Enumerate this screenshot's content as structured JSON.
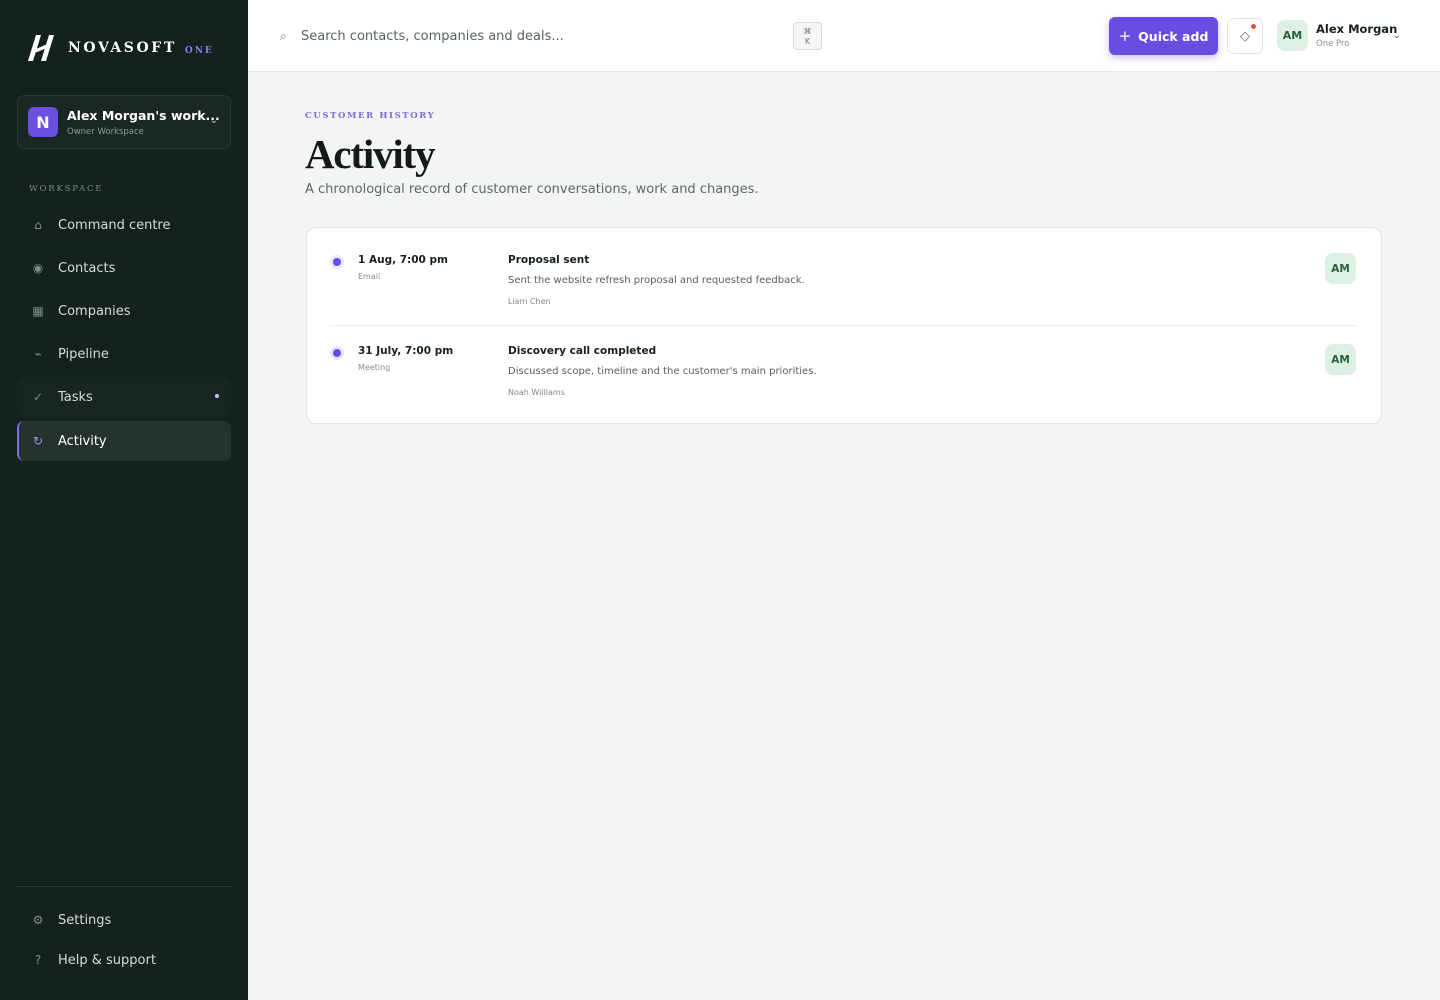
{
  "brand": {
    "name": "NOVASOFT",
    "suffix": "ONE"
  },
  "workspace": {
    "avatar_letter": "N",
    "name": "Alex Morgan's work...",
    "role": "Owner Workspace"
  },
  "sidebar": {
    "section_label": "WORKSPACE",
    "items": [
      {
        "label": "Command centre",
        "icon": "home-icon",
        "glyph": "⌂"
      },
      {
        "label": "Contacts",
        "icon": "contacts-icon",
        "glyph": "◉"
      },
      {
        "label": "Companies",
        "icon": "companies-icon",
        "glyph": "▦"
      },
      {
        "label": "Pipeline",
        "icon": "pipeline-icon",
        "glyph": "⌁"
      },
      {
        "label": "Tasks",
        "icon": "tasks-icon",
        "glyph": "✓"
      },
      {
        "label": "Activity",
        "icon": "activity-icon",
        "glyph": "↻"
      }
    ],
    "footer_items": [
      {
        "label": "Settings",
        "icon": "gear-icon",
        "glyph": "⚙"
      },
      {
        "label": "Help & support",
        "icon": "help-icon",
        "glyph": "?"
      }
    ]
  },
  "topbar": {
    "search_placeholder": "Search contacts, companies and deals...",
    "shortcut_symbol": "⌘",
    "shortcut_key": "K",
    "quick_add_label": "Quick add",
    "user": {
      "initials": "AM",
      "name": "Alex Morgan",
      "plan": "One Pro"
    }
  },
  "page": {
    "eyebrow": "CUSTOMER HISTORY",
    "title": "Activity",
    "subtitle": "A chronological record of customer conversations, work and changes."
  },
  "activities": [
    {
      "date": "1 Aug, 7:00 pm",
      "type": "Email",
      "title": "Proposal sent",
      "description": "Sent the website refresh proposal and requested feedback.",
      "person": "Liam Chen",
      "owner_initials": "AM"
    },
    {
      "date": "31 July, 7:00 pm",
      "type": "Meeting",
      "title": "Discovery call completed",
      "description": "Discussed scope, timeline and the customer's main priorities.",
      "person": "Noah Williams",
      "owner_initials": "AM"
    }
  ],
  "colors": {
    "accent": "#6a4de0",
    "sidebar_bg": "#15211e",
    "page_bg": "#f3f5f2",
    "notification": "#e0513f"
  }
}
